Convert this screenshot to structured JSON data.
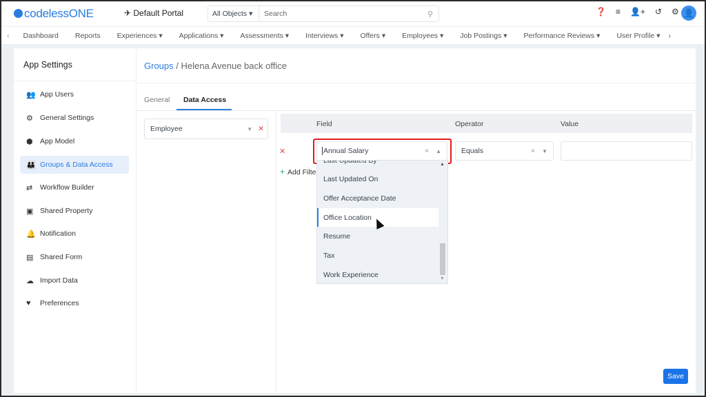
{
  "header": {
    "logo": "codelessONE",
    "portal": "Default Portal",
    "search_scope": "All Objects",
    "search_placeholder": "Search"
  },
  "nav": [
    "Dashboard",
    "Reports",
    "Experiences ▾",
    "Applications ▾",
    "Assessments ▾",
    "Interviews ▾",
    "Offers ▾",
    "Employees ▾",
    "Job Postings ▾",
    "Performance Reviews ▾",
    "User Profile ▾"
  ],
  "sidebar": {
    "title": "App Settings",
    "items": [
      {
        "label": "App Users",
        "icon": "👥"
      },
      {
        "label": "General Settings",
        "icon": "⚙"
      },
      {
        "label": "App Model",
        "icon": "⬢"
      },
      {
        "label": "Groups & Data Access",
        "icon": "👪"
      },
      {
        "label": "Workflow Builder",
        "icon": "⇄"
      },
      {
        "label": "Shared Property",
        "icon": "▣"
      },
      {
        "label": "Notification",
        "icon": "🔔"
      },
      {
        "label": "Shared Form",
        "icon": "▤"
      },
      {
        "label": "Import Data",
        "icon": "☁"
      },
      {
        "label": "Preferences",
        "icon": "♥"
      }
    ]
  },
  "main": {
    "crumb_link": "Groups",
    "crumb_rest": " / Helena Avenue back office",
    "tabs": [
      "General",
      "Data Access"
    ],
    "object": "Employee",
    "columns": [
      "Field",
      "Operator",
      "Value"
    ],
    "field_value": "Annual Salary",
    "operator_value": "Equals",
    "value": "",
    "add_filter": "Add Filter",
    "options": [
      "Last Updated By",
      "Last Updated On",
      "Offer Acceptance Date",
      "Office Location",
      "Resume",
      "Tax",
      "Work Experience"
    ],
    "highlighted": "Office Location",
    "save": "Save"
  }
}
